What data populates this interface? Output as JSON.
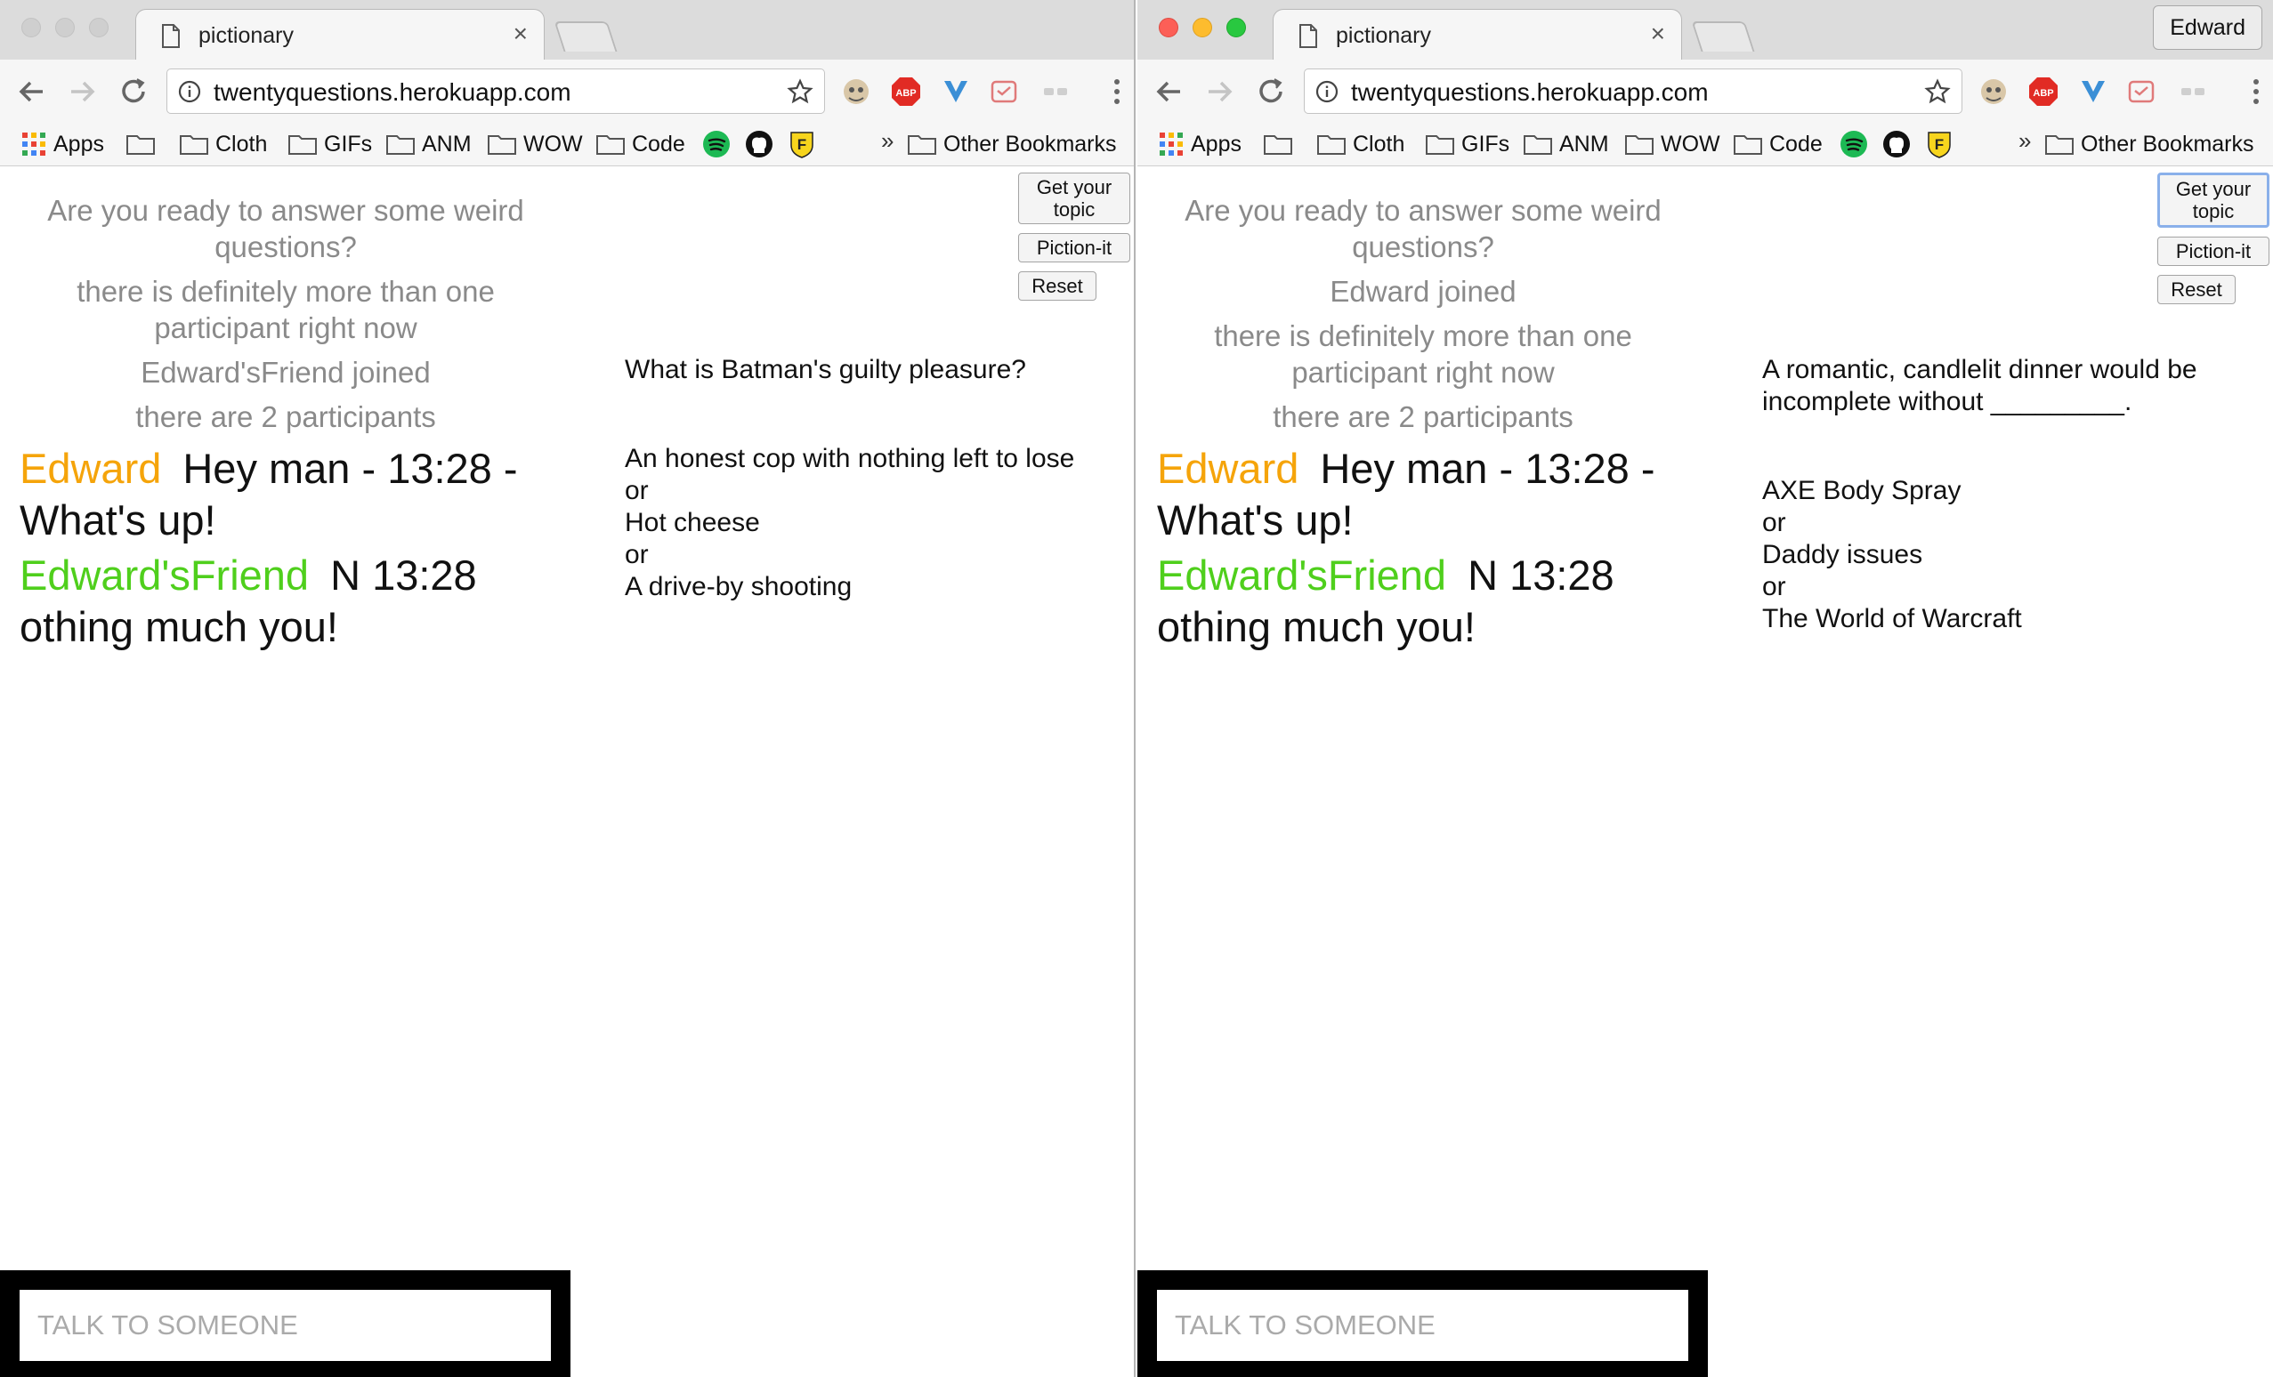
{
  "left_window": {
    "tab_title": "pictionary",
    "tab_close": "×",
    "url": "twentyquestions.herokuapp.com",
    "bookmarks": {
      "apps": "Apps",
      "folders": [
        "Cloth",
        "GIFs",
        "ANM",
        "WOW",
        "Code"
      ],
      "overflow": "»",
      "other": "Other Bookmarks"
    },
    "system_messages": [
      "Are you ready to answer some weird questions?",
      "there is definitely more than one participant right now",
      "Edward'sFriend joined",
      "there are 2 participants"
    ],
    "chat": [
      {
        "name": "Edward",
        "text": "Hey man -  13:28 - What's up!"
      },
      {
        "name": "Edward'sFriend",
        "text": "N 13:28 othing much you!"
      }
    ],
    "buttons": {
      "topic": "Get your topic",
      "piction": "Piction-it",
      "reset": "Reset"
    },
    "question": "What is Batman's guilty pleasure?",
    "answers": [
      "An honest cop with nothing left to lose",
      "or",
      "Hot cheese",
      "or",
      "A drive-by shooting"
    ],
    "input_placeholder": "TALK TO SOMEONE"
  },
  "right_window": {
    "tab_title": "pictionary",
    "tab_close": "×",
    "profile": "Edward",
    "url": "twentyquestions.herokuapp.com",
    "bookmarks": {
      "apps": "Apps",
      "folders": [
        "Cloth",
        "GIFs",
        "ANM",
        "WOW",
        "Code"
      ],
      "overflow": "»",
      "other": "Other Bookmarks"
    },
    "system_messages": [
      "Are you ready to answer some weird questions?",
      "Edward joined",
      "there is definitely more than one participant right now",
      "there are 2 participants"
    ],
    "chat": [
      {
        "name": "Edward",
        "text": "Hey man -  13:28 - What's up!"
      },
      {
        "name": "Edward'sFriend",
        "text": "N 13:28 othing much you!"
      }
    ],
    "buttons": {
      "topic": "Get your topic",
      "piction": "Piction-it",
      "reset": "Reset"
    },
    "question": "A romantic, candlelit dinner would be incomplete without _________.",
    "answers": [
      "AXE Body Spray",
      "or",
      "Daddy issues",
      "or",
      "The World of Warcraft"
    ],
    "input_placeholder": "TALK TO SOMEONE"
  },
  "colors": {
    "user_edward": "#f5a40a",
    "user_friend": "#4fcf1c",
    "system_text": "#8a8a8a",
    "chat_bar": "#000000"
  },
  "icons": [
    "page-icon",
    "back-arrow-icon",
    "forward-arrow-icon",
    "reload-icon",
    "info-icon",
    "star-icon",
    "folder-icon",
    "apps-grid-icon",
    "spotify-icon",
    "github-icon",
    "f-badge-icon",
    "adblock-icon",
    "menu-dots-icon"
  ]
}
